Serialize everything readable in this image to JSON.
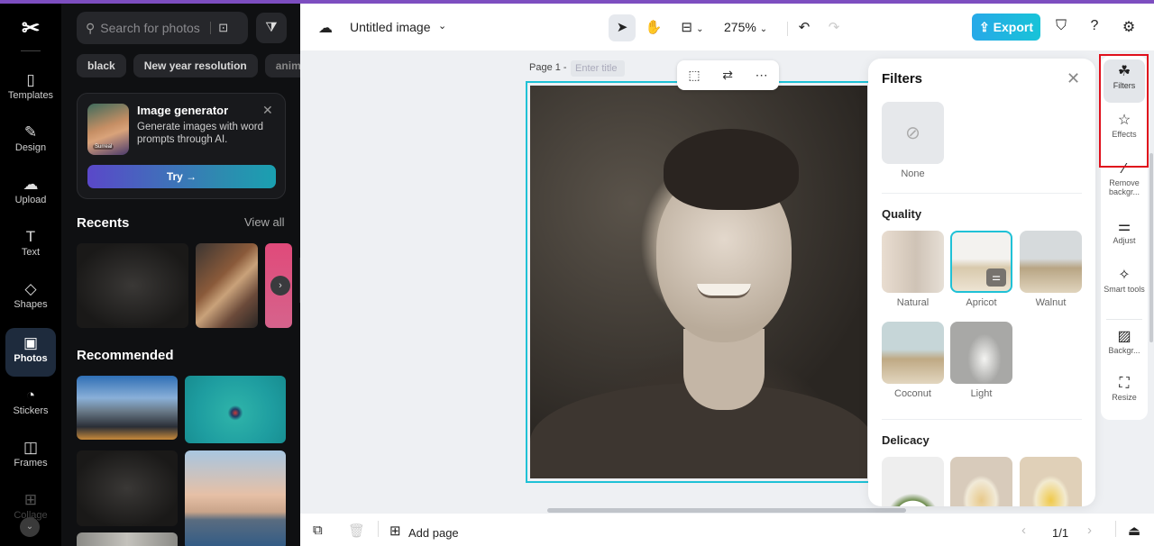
{
  "app": {
    "accent_color": "#7d4ec0"
  },
  "rail": {
    "items": [
      {
        "label": "Templates",
        "icon": "templates-icon"
      },
      {
        "label": "Design",
        "icon": "design-icon"
      },
      {
        "label": "Upload",
        "icon": "upload-icon"
      },
      {
        "label": "Text",
        "icon": "text-icon"
      },
      {
        "label": "Shapes",
        "icon": "shapes-icon"
      },
      {
        "label": "Photos",
        "icon": "photos-icon",
        "active": true
      },
      {
        "label": "Stickers",
        "icon": "stickers-icon"
      },
      {
        "label": "Frames",
        "icon": "frames-icon"
      },
      {
        "label": "Collage",
        "icon": "collage-icon"
      }
    ]
  },
  "panel": {
    "search_placeholder": "Search for photos",
    "chips": [
      "black",
      "New year resolution",
      "anim"
    ],
    "generator": {
      "title": "Image generator",
      "description": "Generate images with word prompts through AI.",
      "thumb_badge": "Surreal",
      "try_label": "Try →"
    },
    "recents_title": "Recents",
    "view_all": "View all",
    "recommended_title": "Recommended"
  },
  "topbar": {
    "doc_title": "Untitled image",
    "zoom": "275%",
    "export_label": "Export",
    "export_color": "#27a9e8"
  },
  "canvas": {
    "page_label": "Page 1 -",
    "page_title_placeholder": "Enter title",
    "selection_color": "#1fc1d6"
  },
  "filters": {
    "title": "Filters",
    "none_label": "None",
    "sections": [
      {
        "title": "Quality",
        "items": [
          "Natural",
          "Apricot",
          "Walnut",
          "Coconut",
          "Light"
        ],
        "selected": "Apricot"
      },
      {
        "title": "Delicacy",
        "items": [
          "",
          "",
          ""
        ]
      }
    ]
  },
  "right_rail": {
    "items": [
      {
        "label": "Filters",
        "selected": true
      },
      {
        "label": "Effects"
      },
      {
        "label": "Remove backgr..."
      },
      {
        "label": "Adjust"
      },
      {
        "label": "Smart tools"
      },
      {
        "label": "Backgr..."
      },
      {
        "label": "Resize"
      }
    ]
  },
  "bottombar": {
    "add_page": "Add page",
    "page_counter": "1/1"
  }
}
